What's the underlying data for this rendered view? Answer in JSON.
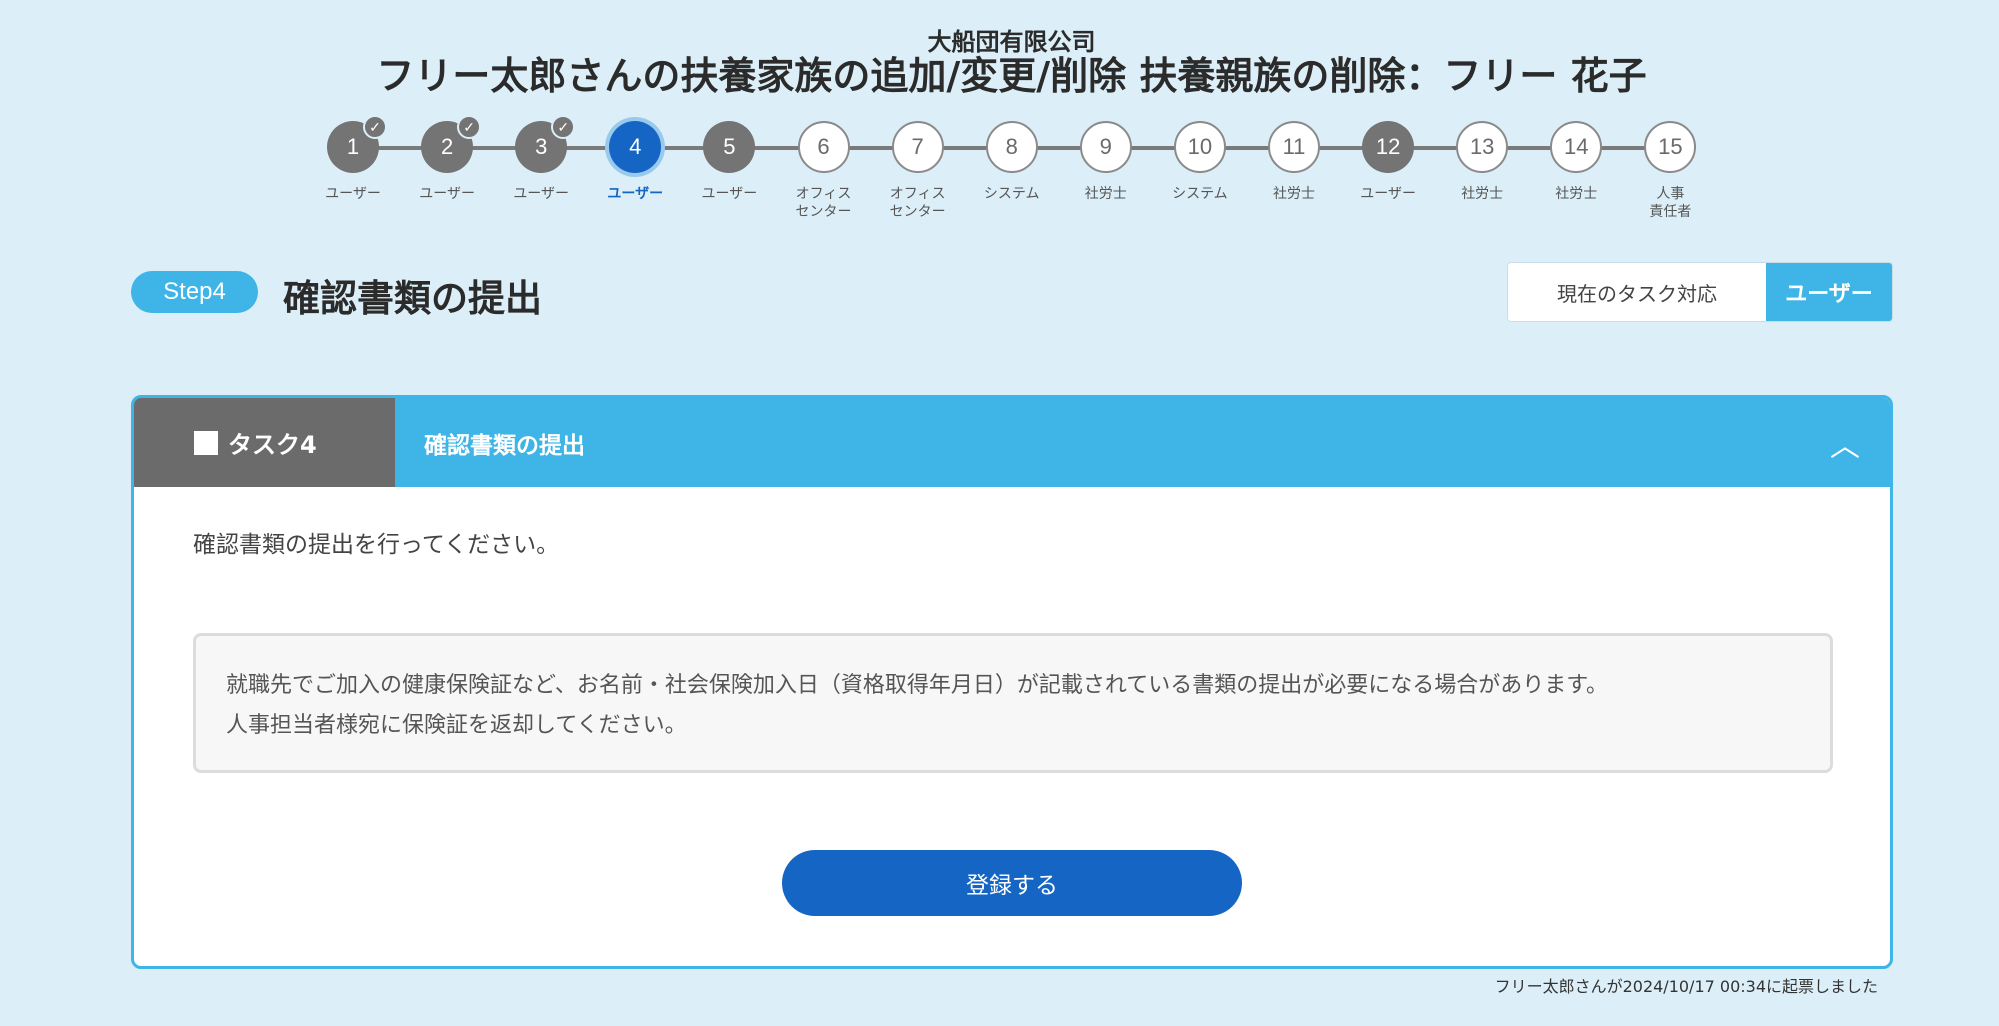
{
  "header": {
    "company": "大船団有限公司",
    "title": "フリー太郎さんの扶養家族の追加/変更/削除 扶養親族の削除：フリー 花子"
  },
  "stepper": {
    "steps": [
      {
        "number": "1",
        "label": "ユーザー",
        "state": "done"
      },
      {
        "number": "2",
        "label": "ユーザー",
        "state": "done"
      },
      {
        "number": "3",
        "label": "ユーザー",
        "state": "done"
      },
      {
        "number": "4",
        "label": "ユーザー",
        "state": "active"
      },
      {
        "number": "5",
        "label": "ユーザー",
        "state": "past"
      },
      {
        "number": "6",
        "label": "オフィス\nセンター",
        "state": "todo"
      },
      {
        "number": "7",
        "label": "オフィス\nセンター",
        "state": "todo"
      },
      {
        "number": "8",
        "label": "システム",
        "state": "todo"
      },
      {
        "number": "9",
        "label": "社労士",
        "state": "todo"
      },
      {
        "number": "10",
        "label": "システム",
        "state": "todo"
      },
      {
        "number": "11",
        "label": "社労士",
        "state": "todo"
      },
      {
        "number": "12",
        "label": "ユーザー",
        "state": "past"
      },
      {
        "number": "13",
        "label": "社労士",
        "state": "todo"
      },
      {
        "number": "14",
        "label": "社労士",
        "state": "todo"
      },
      {
        "number": "15",
        "label": "人事\n責任者",
        "state": "todo"
      }
    ],
    "check_glyph": "✓"
  },
  "step_section": {
    "badge": "Step4",
    "heading": "確認書類の提出"
  },
  "task_owner": {
    "label": "現在のタスク対応",
    "value": "ユーザー"
  },
  "card": {
    "task_tag": "タスク4",
    "title": "確認書類の提出",
    "collapse_glyph": "︿",
    "instruction": "確認書類の提出を行ってください。",
    "note_line1": "就職先でご加入の健康保険証など、お名前・社会保険加入日（資格取得年月日）が記載されている書類の提出が必要になる場合があります。",
    "note_line2": "人事担当者様宛に保険証を返却してください。",
    "submit_label": "登録する"
  },
  "footer": {
    "meta": "フリー太郎さんが2024/10/17 00:34に起票しました"
  },
  "colors": {
    "background": "#dceff8",
    "accent": "#3fb4e6",
    "primary": "#1566c4",
    "done_step": "#747474"
  }
}
